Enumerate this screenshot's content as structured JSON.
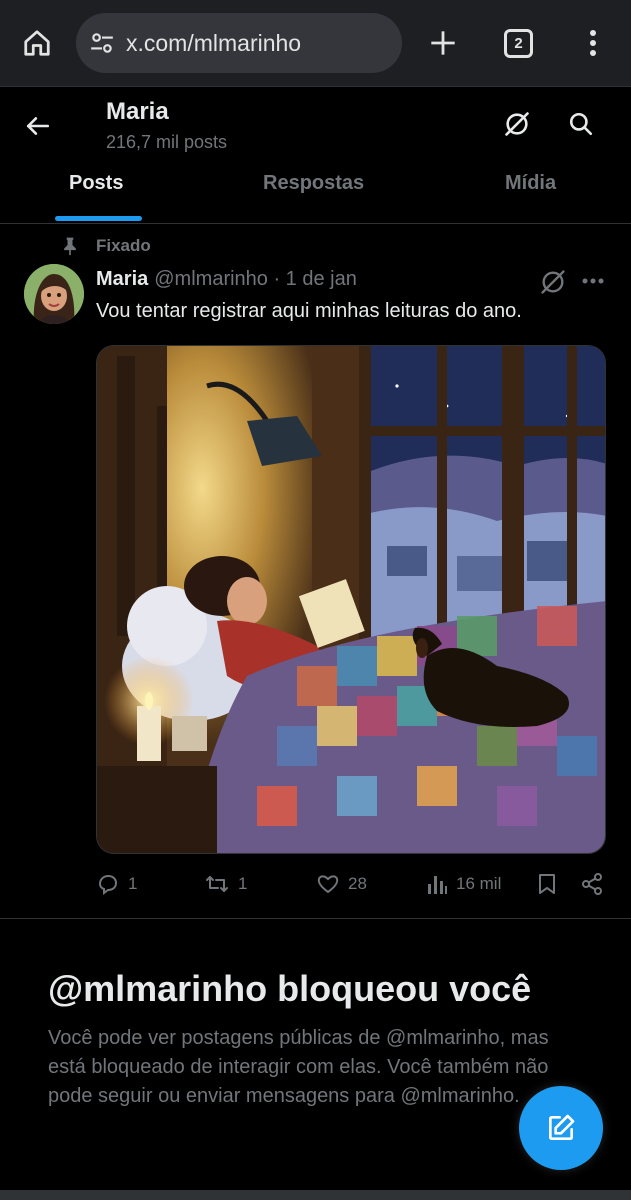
{
  "browser": {
    "url": "x.com/mlmarinho",
    "tab_count": "2"
  },
  "profile": {
    "name": "Maria",
    "post_count": "216,7 mil posts"
  },
  "tabs": [
    {
      "label": "Posts",
      "active": true
    },
    {
      "label": "Respostas",
      "active": false
    },
    {
      "label": "Mídia",
      "active": false
    }
  ],
  "post": {
    "pinned_label": "Fixado",
    "author_name": "Maria",
    "author_handle": "@mlmarinho · 1 de jan",
    "text": "Vou tentar registrar aqui minhas leituras do ano.",
    "replies": "1",
    "reposts": "1",
    "likes": "28",
    "views": "16 mil"
  },
  "blocked": {
    "title": "@mlmarinho bloqueou você",
    "message": "Você pode ver postagens públicas de @mlmarinho, mas está bloqueado de interagir com elas. Você também não pode seguir ou enviar mensagens para @mlmarinho."
  },
  "colors": {
    "accent": "#1d9bf0",
    "muted": "#71767b",
    "text": "#e7e9ea",
    "background": "#000000"
  }
}
